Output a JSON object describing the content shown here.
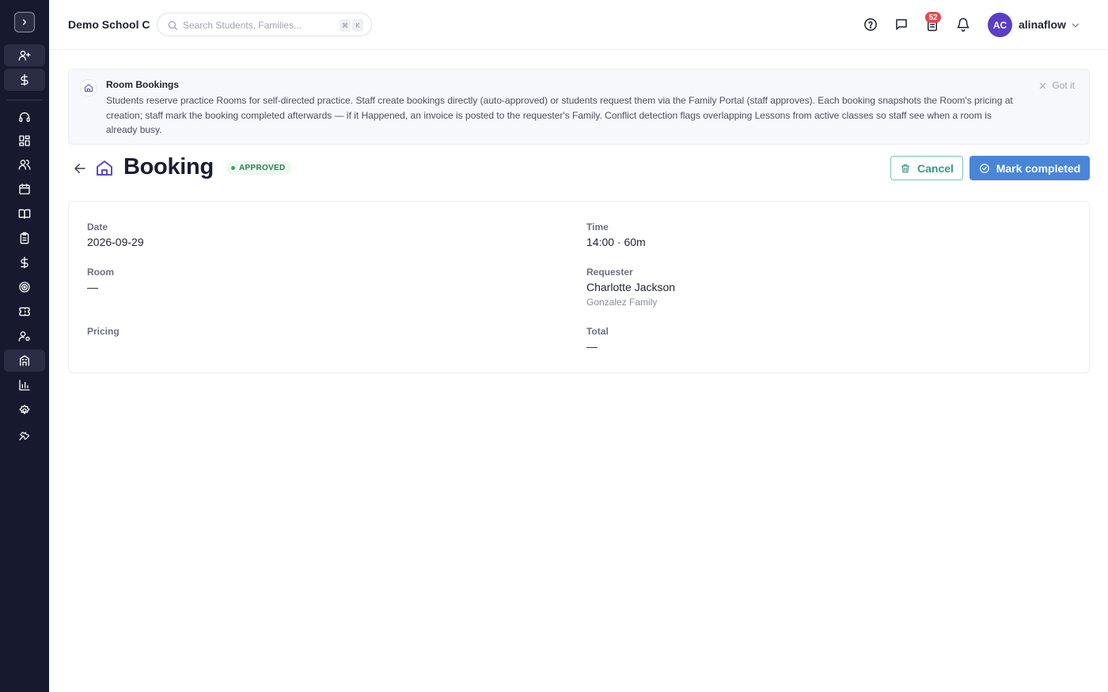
{
  "header": {
    "school_name": "Demo School C",
    "search_placeholder": "Search Students, Families...",
    "shortcut_keys": [
      "⌘",
      "K"
    ],
    "tasks_badge": "52",
    "user": {
      "initials": "AC",
      "name": "alinaflow"
    }
  },
  "sidebar": {
    "items": [
      {
        "icon": "user-plus-icon"
      },
      {
        "icon": "dollar-icon"
      },
      {
        "icon": "headset-icon"
      },
      {
        "icon": "dashboard-grid-icon"
      },
      {
        "icon": "users-icon"
      },
      {
        "icon": "calendar-icon"
      },
      {
        "icon": "book-icon"
      },
      {
        "icon": "clipboard-icon"
      },
      {
        "icon": "dollar-icon"
      },
      {
        "icon": "target-icon"
      },
      {
        "icon": "ticket-icon"
      },
      {
        "icon": "user-cog-icon"
      },
      {
        "icon": "building-icon",
        "active": true
      },
      {
        "icon": "bar-chart-icon"
      },
      {
        "icon": "settings-icon"
      },
      {
        "icon": "wrench-icon"
      }
    ]
  },
  "banner": {
    "title": "Room Bookings",
    "text": "Students reserve practice Rooms for self-directed practice. Staff create bookings directly (auto-approved) or students request them via the Family Portal (staff approves). Each booking snapshots the Room's pricing at creation; staff mark the booking completed afterwards — if it Happened, an invoice is posted to the requester's Family. Conflict detection flags overlapping Lessons from active classes so staff see when a room is already busy.",
    "dismiss_label": "Got it"
  },
  "page": {
    "title": "Booking",
    "status": "APPROVED",
    "cancel_label": "Cancel",
    "complete_label": "Mark completed"
  },
  "details": {
    "date_label": "Date",
    "date_value": "2026-09-29",
    "time_label": "Time",
    "time_value": "14:00 · 60m",
    "room_label": "Room",
    "room_value": "—",
    "requester_label": "Requester",
    "requester_name": "Charlotte Jackson",
    "requester_family": "Gonzalez Family",
    "pricing_label": "Pricing",
    "total_label": "Total",
    "total_value": "—"
  },
  "colors": {
    "sidebar_bg": "#171a2e",
    "primary_button": "#4a86d8",
    "cancel_button": "#3a968a",
    "status_green": "#2f7d4c",
    "avatar": "#5b3fc4",
    "badge": "#e5484d"
  }
}
